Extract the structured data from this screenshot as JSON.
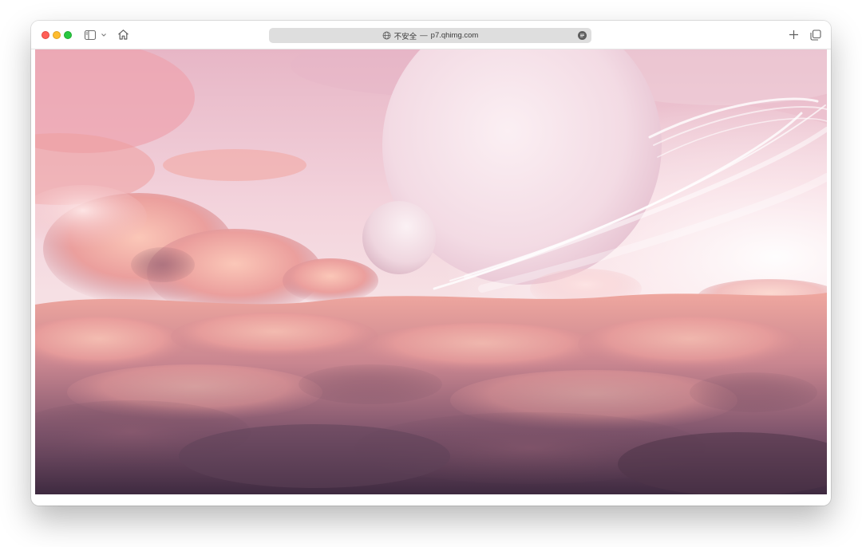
{
  "browser": {
    "address_bar": {
      "security_label": "不安全",
      "separator": "—",
      "domain": "p7.qhimg.com"
    },
    "icons": {
      "sidebar": "sidebar-icon",
      "chevron": "chevron-down-icon",
      "home": "home-icon",
      "globe": "globe-icon",
      "reader": "reader-icon",
      "new_tab": "plus-icon",
      "tab_overview": "tabs-overview-icon"
    }
  },
  "colors": {
    "close": "#ff5f57",
    "minimize": "#febc2e",
    "zoom": "#28c840",
    "address_bg": "#dedede"
  }
}
